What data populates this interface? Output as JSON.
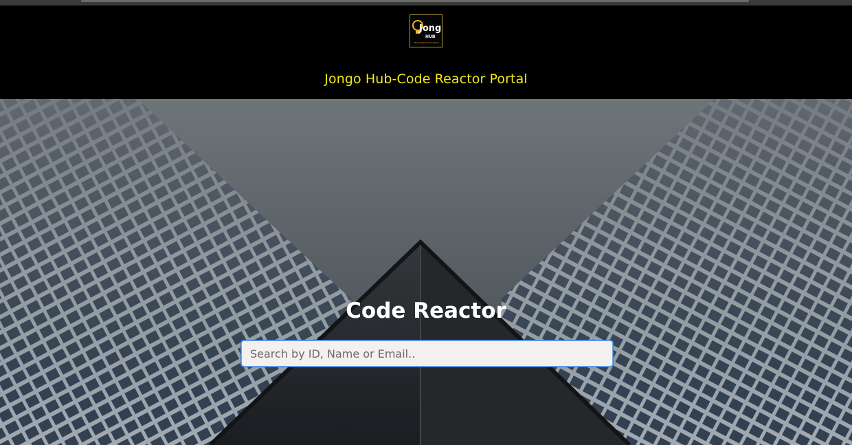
{
  "header": {
    "logo_text": "Jongo",
    "logo_sub": "HUB",
    "logo_tagline": "The Cradle of Innovation",
    "portal_title": "Jongo Hub-Code Reactor Portal"
  },
  "hero": {
    "title": "Code Reactor",
    "search_placeholder": "Search by ID, Name or Email..",
    "search_value": ""
  },
  "colors": {
    "header_bg": "#000000",
    "portal_title": "#f2ea1a",
    "search_focus": "#3f7fd8"
  }
}
